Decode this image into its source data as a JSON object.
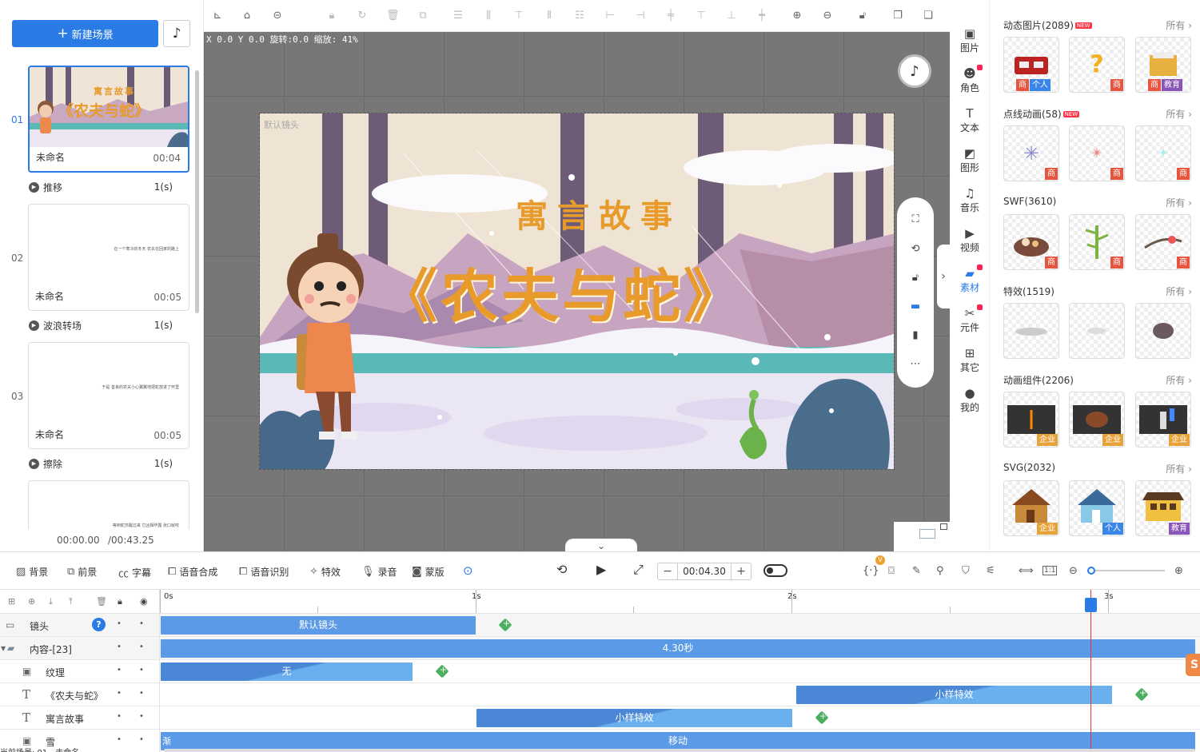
{
  "left_panel": {
    "new_scene_label": "新建场景",
    "scenes": [
      {
        "num": "01",
        "name": "未命名",
        "duration": "00:04",
        "thumb_title_small": "寓言故事",
        "thumb_title_big": "《农夫与蛇》"
      },
      {
        "num": "02",
        "name": "未命名",
        "duration": "00:05",
        "tiny_text": "在一个寒冷的冬天 农夫在回家的路上"
      },
      {
        "num": "03",
        "name": "未命名",
        "duration": "00:05",
        "tiny_text": "于是 善良的农夫小心翼翼地把蛇放进了怀里"
      },
      {
        "num": "",
        "name": "",
        "duration": "",
        "tiny_text": "等到蛇苏醒过来 它凶相毕露 张口就咬"
      }
    ],
    "transitions": [
      {
        "label": "推移",
        "duration": "1(s)"
      },
      {
        "label": "波浪转场",
        "duration": "1(s)"
      },
      {
        "label": "擦除",
        "duration": "1(s)"
      }
    ],
    "current_time": "00:00.00",
    "total_time": "/00:43.25"
  },
  "canvas": {
    "coords_text": "X 0.0 Y 0.0 旋转:0.0 缩放: 41%",
    "lens_label": "默认镜头",
    "title_small": "寓言故事",
    "title_big": "《农夫与蛇》"
  },
  "icon_column": [
    {
      "label": "图片",
      "icon": "image-icon"
    },
    {
      "label": "角色",
      "icon": "character-icon",
      "badge": true
    },
    {
      "label": "文本",
      "icon": "text-icon"
    },
    {
      "label": "图形",
      "icon": "shape-icon"
    },
    {
      "label": "音乐",
      "icon": "music-icon"
    },
    {
      "label": "视频",
      "icon": "video-icon"
    },
    {
      "label": "素材",
      "icon": "folder-icon",
      "badge": true,
      "active": true
    },
    {
      "label": "元件",
      "icon": "component-icon",
      "badge": true
    },
    {
      "label": "其它",
      "icon": "grid-icon"
    },
    {
      "label": "我的",
      "icon": "user-icon"
    }
  ],
  "materials": {
    "all_label": "所有",
    "new_badge": "NEW",
    "categories": [
      {
        "title": "动态图片(2089)",
        "new": true,
        "tiles": [
          {
            "tags": [
              "商",
              "个人"
            ]
          },
          {
            "tags": [
              "商"
            ]
          },
          {
            "tags": [
              "商",
              "教育"
            ]
          }
        ]
      },
      {
        "title": "点线动画(58)",
        "new": true,
        "tiles": [
          {
            "tags": [
              "商"
            ]
          },
          {
            "tags": [
              "商"
            ]
          },
          {
            "tags": [
              "商"
            ]
          }
        ]
      },
      {
        "title": "SWF(3610)",
        "new": false,
        "tiles": [
          {
            "tags": [
              "商"
            ]
          },
          {
            "tags": [
              "商"
            ]
          },
          {
            "tags": [
              "商"
            ]
          }
        ]
      },
      {
        "title": "特效(1519)",
        "new": false,
        "tiles": [
          {
            "tags": []
          },
          {
            "tags": []
          },
          {
            "tags": []
          }
        ]
      },
      {
        "title": "动画组件(2206)",
        "new": false,
        "tiles": [
          {
            "tags": [
              "企业"
            ]
          },
          {
            "tags": [
              "企业"
            ]
          },
          {
            "tags": [
              "企业"
            ]
          }
        ]
      },
      {
        "title": "SVG(2032)",
        "new": false,
        "tiles": [
          {
            "tags": [
              "企业"
            ]
          },
          {
            "tags": [
              "个人"
            ]
          },
          {
            "tags": [
              "教育"
            ]
          }
        ]
      }
    ]
  },
  "timeline_toolbar": {
    "tools": [
      "背景",
      "前景",
      "字幕",
      "语音合成",
      "语音识别",
      "特效",
      "录音",
      "蒙版"
    ],
    "time_value": "00:04.30",
    "badge_v": "V",
    "ratio_label": "1:1"
  },
  "timeline": {
    "ruler_labels": [
      "0s",
      "1s",
      "2s",
      "3s"
    ],
    "tracks": [
      {
        "name": "镜头",
        "clip": "默认镜头"
      },
      {
        "name": "内容-[23]",
        "clip": "4.30秒"
      },
      {
        "name": "纹理",
        "clip": "无"
      },
      {
        "name": "《农夫与蛇》",
        "clip": "小样特效"
      },
      {
        "name": "寓言故事",
        "clip": "小样特效"
      },
      {
        "name": "雪",
        "clip": "移动",
        "clip_prefix": "渐"
      }
    ],
    "status_text": "当前场景: 01 - 未命名"
  }
}
